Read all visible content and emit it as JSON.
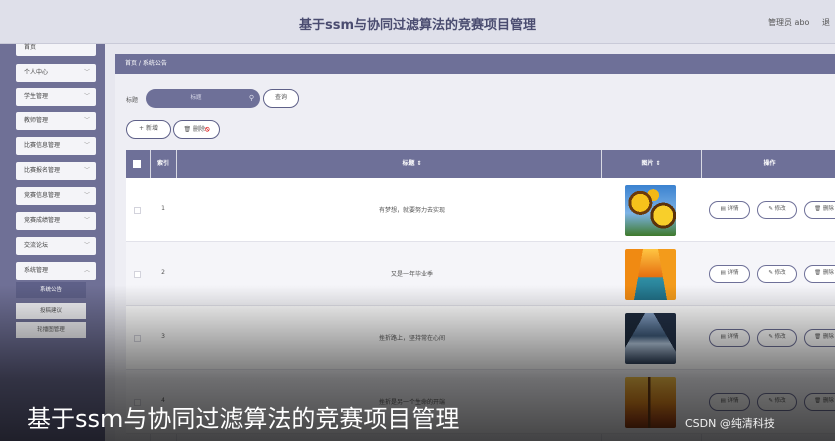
{
  "header": {
    "title": "基于ssm与协同过滤算法的竞赛项目管理",
    "admin": "管理员 abo",
    "logout": "退"
  },
  "sidebar": {
    "items": [
      {
        "label": "首页"
      },
      {
        "label": "个人中心"
      },
      {
        "label": "学生管理"
      },
      {
        "label": "教师管理"
      },
      {
        "label": "比赛信息管理"
      },
      {
        "label": "比赛报名管理"
      },
      {
        "label": "竞赛信息管理"
      },
      {
        "label": "竞赛成绩管理"
      },
      {
        "label": "交流论坛"
      },
      {
        "label": "系统管理"
      }
    ],
    "sub_items": [
      {
        "label": "系统公告",
        "active": true
      },
      {
        "label": "投稿建议",
        "active": false
      },
      {
        "label": "轮播图管理",
        "active": false
      }
    ]
  },
  "breadcrumb": "首页 / 系统公告",
  "search": {
    "label": "标题",
    "placeholder": "标题",
    "query_button": "查询"
  },
  "toolbar": {
    "add": "+ 新增",
    "delete_prefix": "🗑 删",
    "delete_suffix": "除"
  },
  "table": {
    "columns": {
      "index": "索引",
      "title": "标题 ⇕",
      "image": "图片 ⇕",
      "actions": "操作"
    },
    "rows": [
      {
        "index": "1",
        "title": "有梦想，就要努力去实现",
        "image": "sunflowers"
      },
      {
        "index": "2",
        "title": "又是一年毕业季",
        "image": "autumn-lake"
      },
      {
        "index": "3",
        "title": "挫折路上，坚持常在心间",
        "image": "river-valley"
      },
      {
        "index": "4",
        "title": "挫折是另一个生命的开端",
        "image": "autumn-forest"
      }
    ],
    "actions": {
      "detail": "▤ 详情",
      "edit": "✎ 修改",
      "delete": "🗑 删除"
    }
  },
  "overlay": {
    "caption": "基于ssm与协同过滤算法的竞赛项目管理",
    "watermark": "CSDN @纯清科技"
  },
  "colors": {
    "primary": "#6e7098",
    "sidebar": "#6f7096",
    "header_bg": "#dfe0ea",
    "title_text": "#4a4c70"
  }
}
